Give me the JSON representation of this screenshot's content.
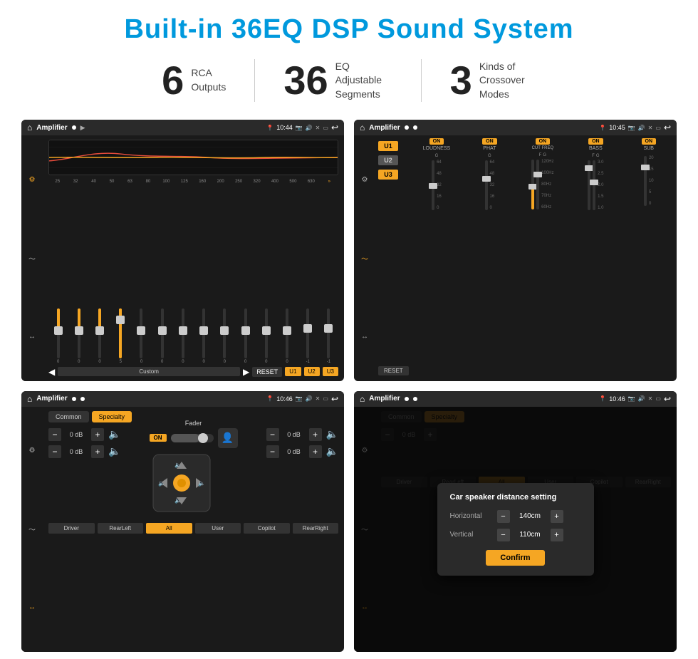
{
  "page": {
    "title": "Built-in 36EQ DSP Sound System",
    "stats": [
      {
        "number": "6",
        "label": "RCA\nOutputs"
      },
      {
        "number": "36",
        "label": "EQ Adjustable\nSegments"
      },
      {
        "number": "3",
        "label": "Kinds of\nCrossover Modes"
      }
    ]
  },
  "screen1": {
    "header": {
      "app": "Amplifier",
      "time": "10:44"
    },
    "preset": "Custom",
    "buttons": {
      "reset": "RESET",
      "u1": "U1",
      "u2": "U2",
      "u3": "U3"
    },
    "freqs": [
      "25",
      "32",
      "40",
      "50",
      "63",
      "80",
      "100",
      "125",
      "160",
      "200",
      "250",
      "320",
      "400",
      "500",
      "630"
    ],
    "values": [
      "0",
      "0",
      "0",
      "5",
      "0",
      "0",
      "0",
      "0",
      "0",
      "0",
      "0",
      "0",
      "-1",
      "-1"
    ]
  },
  "screen2": {
    "header": {
      "app": "Amplifier",
      "time": "10:45"
    },
    "tabs": [
      "U1",
      "U2",
      "U3"
    ],
    "channels": [
      "LOUDNESS",
      "PHAT",
      "CUT FREQ",
      "BASS",
      "SUB"
    ],
    "toggles": [
      "ON",
      "ON",
      "ON",
      "ON",
      "ON"
    ],
    "reset": "RESET"
  },
  "screen3": {
    "header": {
      "app": "Amplifier",
      "time": "10:46"
    },
    "tabs": [
      "Common",
      "Specialty"
    ],
    "fader_label": "Fader",
    "fader_toggle": "ON",
    "rows": [
      {
        "value": "0 dB"
      },
      {
        "value": "0 dB"
      },
      {
        "value": "0 dB"
      },
      {
        "value": "0 dB"
      }
    ],
    "buttons": [
      "Driver",
      "RearLeft",
      "All",
      "User",
      "Copilot",
      "RearRight"
    ]
  },
  "screen4": {
    "header": {
      "app": "Amplifier",
      "time": "10:46"
    },
    "tabs": [
      "Common",
      "Specialty"
    ],
    "dialog": {
      "title": "Car speaker distance setting",
      "horizontal_label": "Horizontal",
      "horizontal_value": "140cm",
      "vertical_label": "Vertical",
      "vertical_value": "110cm",
      "confirm": "Confirm"
    }
  }
}
